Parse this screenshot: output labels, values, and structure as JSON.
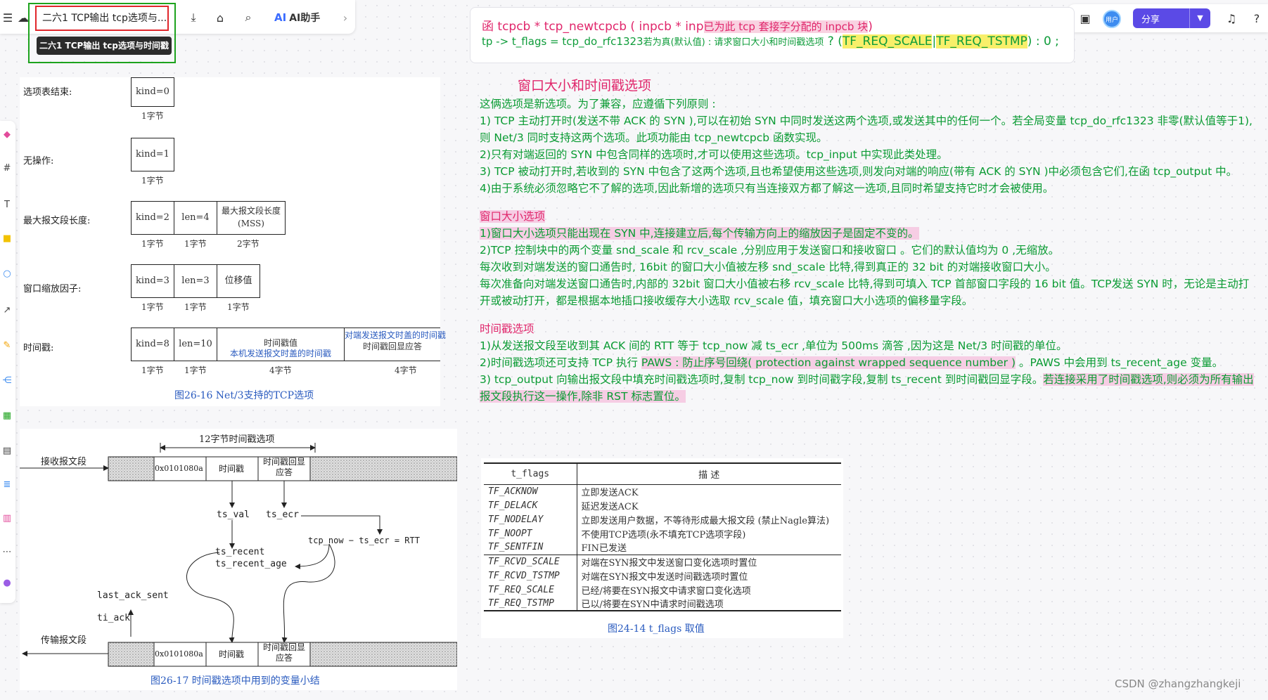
{
  "toolbar_left": {
    "doc_title": "二六1 TCP输出 tcp选项与...",
    "tooltip": "二六1 TCP输出 tcp选项与时间戳",
    "ai_label": "AI助手",
    "ai_logo": "AI"
  },
  "toolbar_right": {
    "avatar_label": "用户",
    "share_label": "分享"
  },
  "code_card": {
    "l1_a": "函 tcpcb * tcp_newtcpcb ( inpcb * inp",
    "l1_b": "已为此 tcp 套接字分配的 inpcb 块",
    "l1_c": ")",
    "l2_a": "tp -> t_flags = tcp_do_rfc1323",
    "l2_b": "若为真(默认值) : 请求窗口大小和时间戳选项",
    "l2_c": " ? (",
    "l2_d": "TF_REQ_SCALE",
    "l2_e": "|",
    "l2_f": "TF_REQ_TSTMP",
    "l2_g": ") : 0 ;"
  },
  "notes": {
    "heading": "窗口大小和时间戳选项",
    "intro": "这俩选项是新选项。为了兼容，应遵循下列原则 :",
    "r1": "1) TCP 主动打开时(发送不带 ACK 的 SYN ),可以在初始 SYN 中同时发送这两个选项,或发送其中的任何一个。若全局变量 tcp_do_rfc1323 非零(默认值等于1),则 Net/3 同时支持这两个选项。此项功能由 tcp_newtcpcb 函数实现。",
    "r2": "2)只有对端返回的 SYN 中包含同样的选项时,才可以使用这些选项。tcp_input 中实现此类处理。",
    "r3": "3) TCP 被动打开时,若收到的 SYN 中包含了这两个选项,且也希望使用这些选项,则发向对端的响应(带有 ACK 的 SYN )中必须包含它们,在函 tcp_output 中。",
    "r4": "4)由于系统必须忽略它不了解的选项,因此新增的选项只有当连接双方都了解这一选项,且同时希望支持它时才会被使用。",
    "win_heading": "窗口大小选项",
    "w1": "1)窗口大小选项只能出现在 SYN 中,连接建立后,每个传输方向上的缩放因子是固定不变的。",
    "w2": "2)TCP 控制块中的两个变量 snd_scale 和 rcv_scale ,分别应用于发送窗口和接收窗口 。它们的默认值均为 0 ,无缩放。",
    "w3": "每次收到对端发送的窗口通告时, 16bit 的窗口大小值被左移 snd_scale 比特,得到真正的 32 bit 的对端接收窗口大小。",
    "w4": "每次准备向对端发送窗口通告时,内部的 32bit 窗口大小值被右移 rcv_scale 比特,得到可填入 TCP 首部窗口字段的 16 bit 值。TCP发送 SYN 时，无论是主动打开或被动打开，都是根据本地插口接收缓存大小选取 rcv_scale 值，填充窗口大小选项的偏移量字段。",
    "ts_heading": "时间戳选项",
    "t1": "1)从发送报文段至收到其 ACK 间的 RTT 等于 tcp_now 减 ts_ecr ,单位为 500ms 滴答 ,因为这是 Net/3 时间戳的单位。",
    "t2a": "2)时间戳选项还可支持 TCP 执行 ",
    "t2b": "PAWS : 防止序号回绕( protection  against  wrapped  sequence number )",
    "t2c": " 。PAWS 中会用到 ts_recent_age 变量。",
    "t3a": "3) tcp_output 向输出报文段中填充时间戳选项时,复制 tcp_now 到时间戳字段,复制 ts_recent 到时间戳回显字段。",
    "t3b": "若连接采用了时间戳选项,则必须为所有输出报文段执行这一操作,除非 RST 标志置位。"
  },
  "fig1": {
    "r1_label": "选项表结束:",
    "r1_kind": "kind=0",
    "byte1": "1字节",
    "r2_label": "无操作:",
    "r2_kind": "kind=1",
    "r3_label": "最大报文段长度:",
    "r3_kind": "kind=2",
    "r3_len": "len=4",
    "r3_mss": "最大报文段长度(MSS)",
    "byte2": "2字节",
    "r4_label": "窗口缩放因子:",
    "r4_kind": "kind=3",
    "r4_len": "len=3",
    "r4_shift": "位移值",
    "r5_label": "时间戳:",
    "r5_kind": "kind=8",
    "r5_len": "len=10",
    "r5_ts": "时间戳值",
    "r5_ts_note": "本机发送报文时盖的时间戳",
    "r5_echo": "时间戳回显应答",
    "r5_echo_note": "对端发送报文时盖的时间戳",
    "byte4": "4字节",
    "caption": "图26-16   Net/3支持的TCP选项"
  },
  "fig2": {
    "span": "12字节时间戳选项",
    "recv": "接收报文段",
    "send": "传输报文段",
    "hex": "0x0101080a",
    "ts": "时间戳",
    "echo": "时间戳回显应答",
    "ts_val": "ts_val",
    "ts_ecr": "ts_ecr",
    "rtt": "tcp_now − ts_ecr = RTT",
    "ts_recent": "ts_recent",
    "ts_recent_age": "ts_recent_age",
    "last_ack": "last_ack_sent",
    "ti_ack": "ti_ack",
    "caption": "图26-17   时间戳选项中用到的变量小结"
  },
  "fig3": {
    "col1": "t_flags",
    "col2": "描    述",
    "rows": [
      {
        "flag": "TF_ACKNOW",
        "desc": "立即发送ACK"
      },
      {
        "flag": "TF_DELACK",
        "desc": "延迟发送ACK"
      },
      {
        "flag": "TF_NODELAY",
        "desc": "立即发送用户数据，不等待形成最大报文段 (禁止Nagle算法)"
      },
      {
        "flag": "TF_NOOPT",
        "desc": "不使用TCP选项(永不填充TCP选项字段)"
      },
      {
        "flag": "TF_SENTFIN",
        "desc": "FIN已发送"
      },
      {
        "flag": "TF_RCVD_SCALE",
        "desc": "对端在SYN报文中发送窗口变化选项时置位"
      },
      {
        "flag": "TF_RCVD_TSTMP",
        "desc": "对端在SYN报文中发送时间戳选项时置位"
      },
      {
        "flag": "TF_REQ_SCALE",
        "desc": "已经/将要在SYN报文中请求窗口变化选项"
      },
      {
        "flag": "TF_REQ_TSTMP",
        "desc": "已以/将要在SYN中请求时间戳选项"
      }
    ],
    "caption": "图24-14   t_flags 取值"
  },
  "watermark": "CSDN @zhangzhangkeji"
}
